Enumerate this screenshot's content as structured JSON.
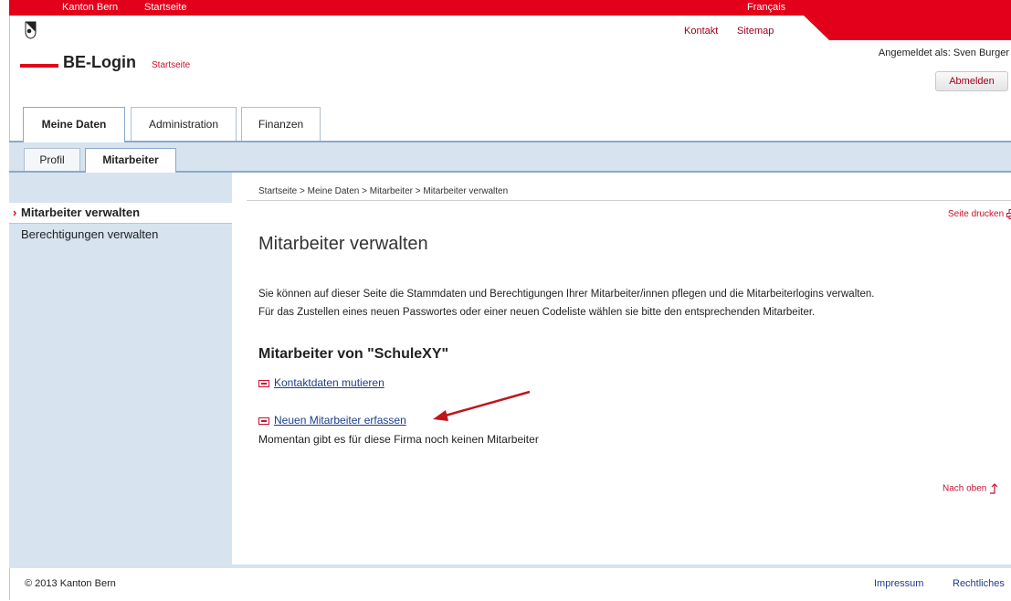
{
  "topbar": {
    "canton": "Kanton Bern",
    "home": "Startseite",
    "lang": "Français"
  },
  "header": {
    "brand": "BE-Login",
    "brand_sub": "Startseite",
    "contact": "Kontakt",
    "sitemap": "Sitemap",
    "logged_in": "Angemeldet als: Sven Burger",
    "logout": "Abmelden"
  },
  "main_tabs": [
    {
      "label": "Meine Daten",
      "active": true
    },
    {
      "label": "Administration",
      "active": false
    },
    {
      "label": "Finanzen",
      "active": false
    }
  ],
  "sub_tabs": [
    {
      "label": "Profil",
      "active": false
    },
    {
      "label": "Mitarbeiter",
      "active": true
    }
  ],
  "sidebar": {
    "items": [
      {
        "label": "Mitarbeiter verwalten",
        "active": true
      },
      {
        "label": "Berechtigungen verwalten",
        "active": false
      }
    ]
  },
  "breadcrumb": "Startseite > Meine Daten > Mitarbeiter > Mitarbeiter verwalten",
  "print_label": "Seite drucken",
  "content": {
    "title": "Mitarbeiter verwalten",
    "intro_line1": "Sie können auf dieser Seite die Stammdaten und Berechtigungen Ihrer Mitarbeiter/innen pflegen und die Mitarbeiterlogins verwalten.",
    "intro_line2": "Für das Zustellen eines neuen Passwortes oder einer neuen Codeliste wählen sie bitte den entsprechenden Mitarbeiter.",
    "section_title": "Mitarbeiter von \"SchuleXY\"",
    "edit_contact": "Kontaktdaten mutieren",
    "new_employee": "Neuen Mitarbeiter erfassen",
    "empty_note": "Momentan gibt es für diese Firma noch keinen Mitarbeiter",
    "to_top": "Nach oben"
  },
  "footer": {
    "copyright": "© 2013 Kanton Bern",
    "impressum": "Impressum",
    "legal": "Rechtliches"
  },
  "colors": {
    "brand_red": "#e2001a",
    "nav_blue": "#d7e3ef",
    "link_blue": "#1a3f8c"
  },
  "icons": [
    "bern-crest-icon",
    "printer-icon",
    "arrow-up-icon",
    "action-arrow-icon",
    "chevron-right-icon"
  ]
}
